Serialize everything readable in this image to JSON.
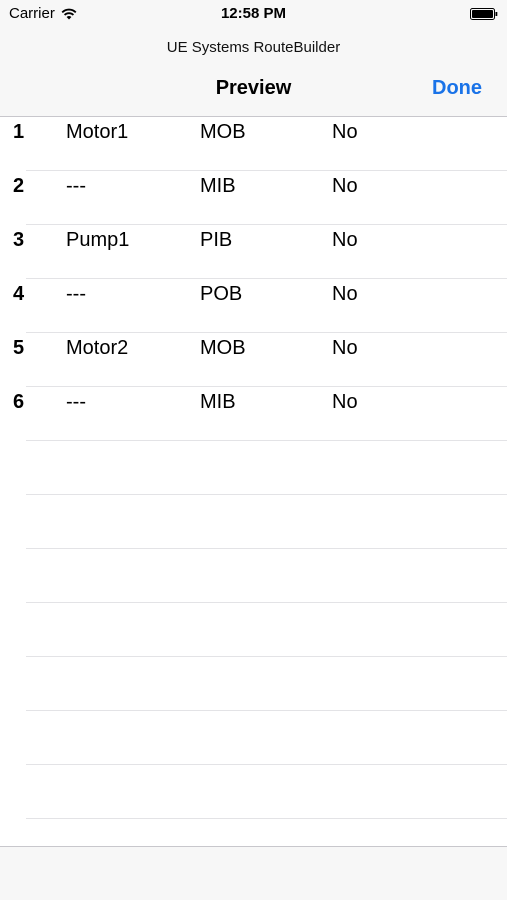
{
  "status_bar": {
    "carrier": "Carrier",
    "time": "12:58 PM"
  },
  "header": {
    "app_title": "UE Systems RouteBuilder",
    "title": "Preview",
    "done_label": "Done",
    "accent_color": "#1a73e8"
  },
  "rows": [
    {
      "num": "1",
      "name": "Motor1",
      "code": "MOB",
      "flag": "No"
    },
    {
      "num": "2",
      "name": "---",
      "code": "MIB",
      "flag": "No"
    },
    {
      "num": "3",
      "name": "Pump1",
      "code": "PIB",
      "flag": "No"
    },
    {
      "num": "4",
      "name": "---",
      "code": "POB",
      "flag": "No"
    },
    {
      "num": "5",
      "name": "Motor2",
      "code": "MOB",
      "flag": "No"
    },
    {
      "num": "6",
      "name": "---",
      "code": "MIB",
      "flag": "No"
    }
  ]
}
